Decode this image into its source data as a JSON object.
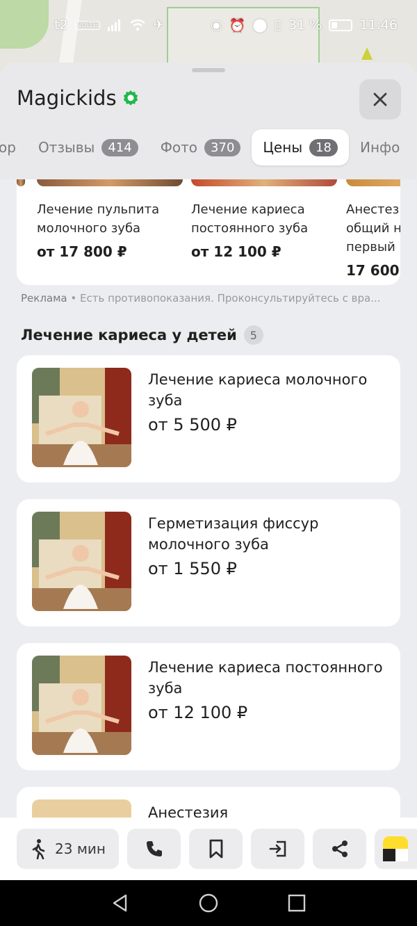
{
  "status_bar": {
    "carrier": "t2",
    "volte": "VoLTE",
    "battery": "31 %",
    "time": "11:46"
  },
  "header": {
    "title": "Magickids"
  },
  "tabs": [
    {
      "label": "ор",
      "count": ""
    },
    {
      "label": "Отзывы",
      "count": "414"
    },
    {
      "label": "Фото",
      "count": "370"
    },
    {
      "label": "Цены",
      "count": "18"
    },
    {
      "label": "Инфо",
      "count": ""
    }
  ],
  "promo_strip": [
    {
      "title": "Лечение пульпита молочного зуба",
      "price": "от 17 800 ₽"
    },
    {
      "title": "Лечение кариеса постоянного зуба",
      "price": "от 12 100 ₽"
    },
    {
      "title": "Анестез общий н первый",
      "price": "17 600"
    }
  ],
  "ad_note": {
    "label": "Реклама",
    "text": " • Есть противопоказания. Проконсультируйтесь с вра..."
  },
  "section": {
    "title": "Лечение кариеса у детей",
    "count": "5"
  },
  "services": [
    {
      "name": "Лечение кариеса молочного зуба",
      "price": "от 5 500 ₽"
    },
    {
      "name": "Герметизация фиссур молочного зуба",
      "price": "от 1 550 ₽"
    },
    {
      "name": "Лечение кариеса постоянного зуба",
      "price": "от 12 100 ₽"
    },
    {
      "name": "Анестезия",
      "price": ""
    }
  ],
  "actions": {
    "walk_time": "23 мин"
  },
  "colors": {
    "accent_verified": "#1fb84a",
    "text": "#21201f",
    "background": "#ecedf0"
  }
}
